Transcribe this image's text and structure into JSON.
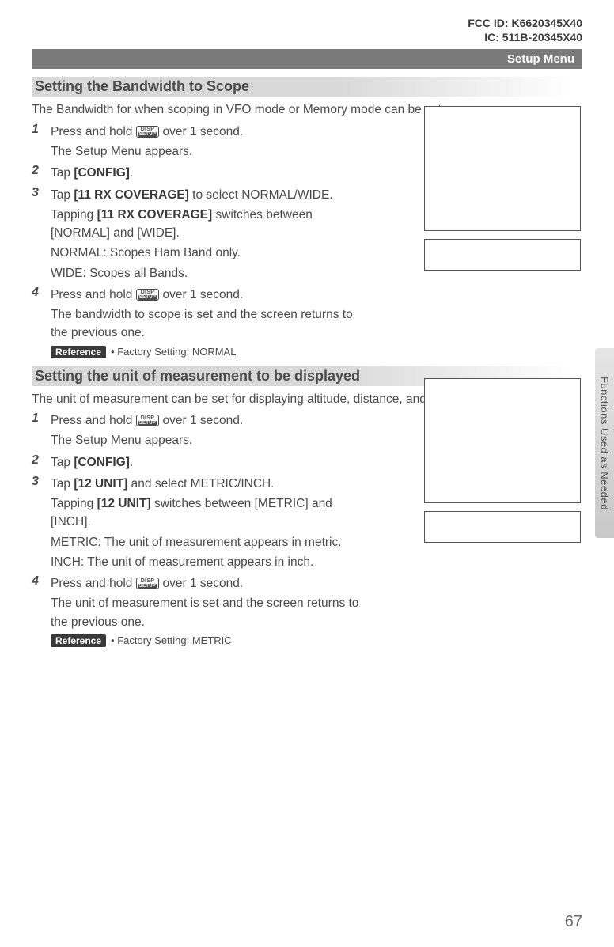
{
  "header": {
    "fcc": "FCC ID: K6620345X40",
    "ic": "IC: 511B-20345X40"
  },
  "menu_bar": "Setup Menu",
  "side_tab": "Functions Used as Needed",
  "page_number": "67",
  "disp_key": {
    "top": "DISP",
    "bottom": "SETUP"
  },
  "ref_label": "Reference",
  "section1": {
    "title": "Setting the Bandwidth to Scope",
    "intro": "The Bandwidth for when scoping in VFO mode or Memory mode can be set.",
    "steps": {
      "s1a": "Press and hold ",
      "s1b": " over 1 second.",
      "s1sub": "The Setup Menu appears.",
      "s2a": "Tap ",
      "s2b": "[CONFIG]",
      "s2c": ".",
      "s3a": "Tap ",
      "s3b": "[11 RX COVERAGE]",
      "s3c": " to select NORMAL/WIDE.",
      "s3sub1a": "Tapping ",
      "s3sub1b": "[11 RX COVERAGE]",
      "s3sub1c": " switches between [NORMAL] and [WIDE].",
      "s3sub2": "NORMAL: Scopes Ham Band only.",
      "s3sub3": "WIDE: Scopes all Bands.",
      "s4a": "Press and hold ",
      "s4b": " over 1 second.",
      "s4sub": "The bandwidth to scope is set and the screen returns to the previous one."
    },
    "reference": "• Factory Setting: NORMAL"
  },
  "section2": {
    "title": "Setting the unit of measurement to be displayed",
    "intro": "The unit of measurement can be set for displaying altitude, distance, and speed.",
    "steps": {
      "s1a": "Press and hold ",
      "s1b": " over 1 second.",
      "s1sub": "The Setup Menu appears.",
      "s2a": "Tap ",
      "s2b": "[CONFIG]",
      "s2c": ".",
      "s3a": "Tap ",
      "s3b": "[12 UNIT]",
      "s3c": " and select METRIC/INCH.",
      "s3sub1a": "Tapping ",
      "s3sub1b": "[12 UNIT]",
      "s3sub1c": " switches between [METRIC] and [INCH].",
      "s3sub2": "METRIC: The unit of measurement appears in metric.",
      "s3sub3": "INCH: The unit of measurement appears in inch.",
      "s4a": "Press and hold ",
      "s4b": " over 1 second.",
      "s4sub": "The unit of measurement is set and the screen returns to the previous one."
    },
    "reference": "• Factory Setting: METRIC"
  }
}
